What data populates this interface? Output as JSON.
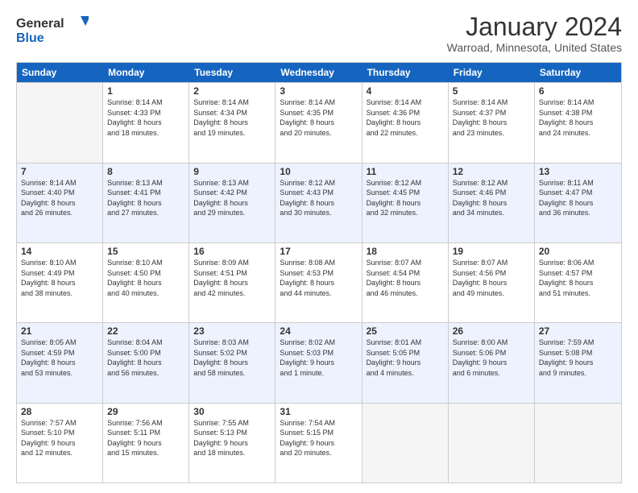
{
  "logo": {
    "text_general": "General",
    "text_blue": "Blue"
  },
  "title": "January 2024",
  "subtitle": "Warroad, Minnesota, United States",
  "weekdays": [
    "Sunday",
    "Monday",
    "Tuesday",
    "Wednesday",
    "Thursday",
    "Friday",
    "Saturday"
  ],
  "weeks": [
    [
      {
        "day": "",
        "info": "",
        "empty": true
      },
      {
        "day": "1",
        "info": "Sunrise: 8:14 AM\nSunset: 4:33 PM\nDaylight: 8 hours\nand 18 minutes."
      },
      {
        "day": "2",
        "info": "Sunrise: 8:14 AM\nSunset: 4:34 PM\nDaylight: 8 hours\nand 19 minutes."
      },
      {
        "day": "3",
        "info": "Sunrise: 8:14 AM\nSunset: 4:35 PM\nDaylight: 8 hours\nand 20 minutes."
      },
      {
        "day": "4",
        "info": "Sunrise: 8:14 AM\nSunset: 4:36 PM\nDaylight: 8 hours\nand 22 minutes."
      },
      {
        "day": "5",
        "info": "Sunrise: 8:14 AM\nSunset: 4:37 PM\nDaylight: 8 hours\nand 23 minutes."
      },
      {
        "day": "6",
        "info": "Sunrise: 8:14 AM\nSunset: 4:38 PM\nDaylight: 8 hours\nand 24 minutes."
      }
    ],
    [
      {
        "day": "7",
        "info": "Sunrise: 8:14 AM\nSunset: 4:40 PM\nDaylight: 8 hours\nand 26 minutes."
      },
      {
        "day": "8",
        "info": "Sunrise: 8:13 AM\nSunset: 4:41 PM\nDaylight: 8 hours\nand 27 minutes."
      },
      {
        "day": "9",
        "info": "Sunrise: 8:13 AM\nSunset: 4:42 PM\nDaylight: 8 hours\nand 29 minutes."
      },
      {
        "day": "10",
        "info": "Sunrise: 8:12 AM\nSunset: 4:43 PM\nDaylight: 8 hours\nand 30 minutes."
      },
      {
        "day": "11",
        "info": "Sunrise: 8:12 AM\nSunset: 4:45 PM\nDaylight: 8 hours\nand 32 minutes."
      },
      {
        "day": "12",
        "info": "Sunrise: 8:12 AM\nSunset: 4:46 PM\nDaylight: 8 hours\nand 34 minutes."
      },
      {
        "day": "13",
        "info": "Sunrise: 8:11 AM\nSunset: 4:47 PM\nDaylight: 8 hours\nand 36 minutes."
      }
    ],
    [
      {
        "day": "14",
        "info": "Sunrise: 8:10 AM\nSunset: 4:49 PM\nDaylight: 8 hours\nand 38 minutes."
      },
      {
        "day": "15",
        "info": "Sunrise: 8:10 AM\nSunset: 4:50 PM\nDaylight: 8 hours\nand 40 minutes."
      },
      {
        "day": "16",
        "info": "Sunrise: 8:09 AM\nSunset: 4:51 PM\nDaylight: 8 hours\nand 42 minutes."
      },
      {
        "day": "17",
        "info": "Sunrise: 8:08 AM\nSunset: 4:53 PM\nDaylight: 8 hours\nand 44 minutes."
      },
      {
        "day": "18",
        "info": "Sunrise: 8:07 AM\nSunset: 4:54 PM\nDaylight: 8 hours\nand 46 minutes."
      },
      {
        "day": "19",
        "info": "Sunrise: 8:07 AM\nSunset: 4:56 PM\nDaylight: 8 hours\nand 49 minutes."
      },
      {
        "day": "20",
        "info": "Sunrise: 8:06 AM\nSunset: 4:57 PM\nDaylight: 8 hours\nand 51 minutes."
      }
    ],
    [
      {
        "day": "21",
        "info": "Sunrise: 8:05 AM\nSunset: 4:59 PM\nDaylight: 8 hours\nand 53 minutes."
      },
      {
        "day": "22",
        "info": "Sunrise: 8:04 AM\nSunset: 5:00 PM\nDaylight: 8 hours\nand 56 minutes."
      },
      {
        "day": "23",
        "info": "Sunrise: 8:03 AM\nSunset: 5:02 PM\nDaylight: 8 hours\nand 58 minutes."
      },
      {
        "day": "24",
        "info": "Sunrise: 8:02 AM\nSunset: 5:03 PM\nDaylight: 9 hours\nand 1 minute."
      },
      {
        "day": "25",
        "info": "Sunrise: 8:01 AM\nSunset: 5:05 PM\nDaylight: 9 hours\nand 4 minutes."
      },
      {
        "day": "26",
        "info": "Sunrise: 8:00 AM\nSunset: 5:06 PM\nDaylight: 9 hours\nand 6 minutes."
      },
      {
        "day": "27",
        "info": "Sunrise: 7:59 AM\nSunset: 5:08 PM\nDaylight: 9 hours\nand 9 minutes."
      }
    ],
    [
      {
        "day": "28",
        "info": "Sunrise: 7:57 AM\nSunset: 5:10 PM\nDaylight: 9 hours\nand 12 minutes."
      },
      {
        "day": "29",
        "info": "Sunrise: 7:56 AM\nSunset: 5:11 PM\nDaylight: 9 hours\nand 15 minutes."
      },
      {
        "day": "30",
        "info": "Sunrise: 7:55 AM\nSunset: 5:13 PM\nDaylight: 9 hours\nand 18 minutes."
      },
      {
        "day": "31",
        "info": "Sunrise: 7:54 AM\nSunset: 5:15 PM\nDaylight: 9 hours\nand 20 minutes."
      },
      {
        "day": "",
        "info": "",
        "empty": true
      },
      {
        "day": "",
        "info": "",
        "empty": true
      },
      {
        "day": "",
        "info": "",
        "empty": true
      }
    ]
  ]
}
